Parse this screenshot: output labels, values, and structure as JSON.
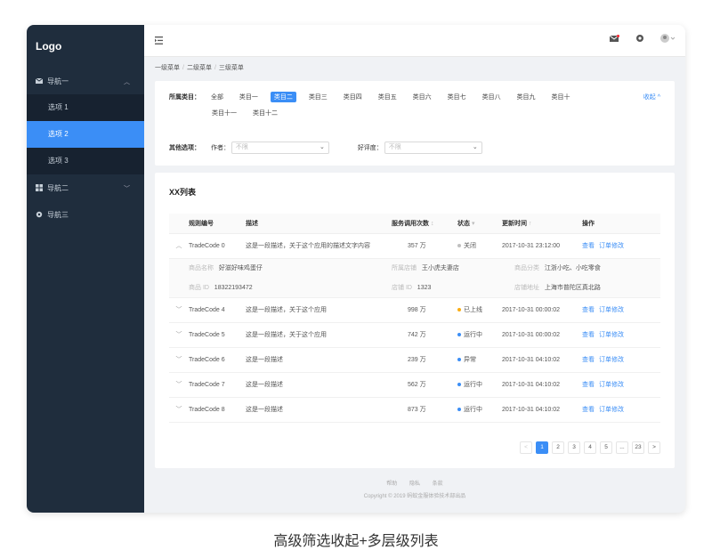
{
  "logo": "Logo",
  "sidebar": {
    "group1": "导航一",
    "items": [
      "选项 1",
      "选项 2",
      "选项 3"
    ],
    "group2": "导航二",
    "group3": "导航三"
  },
  "breadcrumb": [
    "一级菜单",
    "二级菜单",
    "三级菜单"
  ],
  "filter": {
    "category_label": "所属类目：",
    "tags": [
      "全部",
      "类目一",
      "类目二",
      "类目三",
      "类目四",
      "类目五",
      "类目六",
      "类目七",
      "类目八",
      "类目九",
      "类目十",
      "类目十一",
      "类目十二"
    ],
    "selected_index": 2,
    "collapse": "收起 ^",
    "other_label": "其他选项：",
    "author_label": "作者：",
    "author_placeholder": "不限",
    "rating_label": "好评度：",
    "rating_placeholder": "不限"
  },
  "table": {
    "title": "XX列表",
    "headers": [
      "规则编号",
      "描述",
      "服务调用次数",
      "状态",
      "更新时间",
      "操作"
    ],
    "rows": [
      {
        "code": "TradeCode 0",
        "desc": "这是一段描述，关于这个应用的描述文字内容",
        "count": "357 万",
        "status": "关闭",
        "status_color": "#bfbfbf",
        "time": "2017-10-31 23:12:00"
      },
      {
        "code": "TradeCode 4",
        "desc": "这是一段描述，关于这个应用",
        "count": "998 万",
        "status": "已上线",
        "status_color": "#faad14",
        "time": "2017-10-31 00:00:02"
      },
      {
        "code": "TradeCode 5",
        "desc": "这是一段描述，关于这个应用",
        "count": "742 万",
        "status": "运行中",
        "status_color": "#3b8ef6",
        "time": "2017-10-31 00:00:02"
      },
      {
        "code": "TradeCode 6",
        "desc": "这是一段描述",
        "count": "239 万",
        "status": "异常",
        "status_color": "#3b8ef6",
        "time": "2017-10-31 04:10:02"
      },
      {
        "code": "TradeCode 7",
        "desc": "这是一段描述",
        "count": "562 万",
        "status": "运行中",
        "status_color": "#3b8ef6",
        "time": "2017-10-31 04:10:02"
      },
      {
        "code": "TradeCode 8",
        "desc": "这是一段描述",
        "count": "873 万",
        "status": "运行中",
        "status_color": "#3b8ef6",
        "time": "2017-10-31 04:10:02"
      }
    ],
    "expand": {
      "l1": "商品名称",
      "v1": "好滋好味鸡蛋仔",
      "l2": "所属店铺",
      "v2": "王小虎夫妻店",
      "l3": "商品分类",
      "v3": "江浙小吃、小吃零食",
      "l4": "商品 ID",
      "v4": "18322193472",
      "l5": "店铺 ID",
      "v5": "1323",
      "l6": "店铺地址",
      "v6": "上海市普陀区真北路"
    },
    "action_view": "查看",
    "action_edit": "订单修改"
  },
  "pager": [
    "<",
    "1",
    "2",
    "3",
    "4",
    "5",
    "...",
    "23",
    ">"
  ],
  "footer": {
    "links": [
      "帮助",
      "隐私",
      "条款"
    ],
    "copyright": "Copyright © 2019 蚂蚁金服体验技术部出品"
  },
  "caption": "高级筛选收起+多层级列表"
}
